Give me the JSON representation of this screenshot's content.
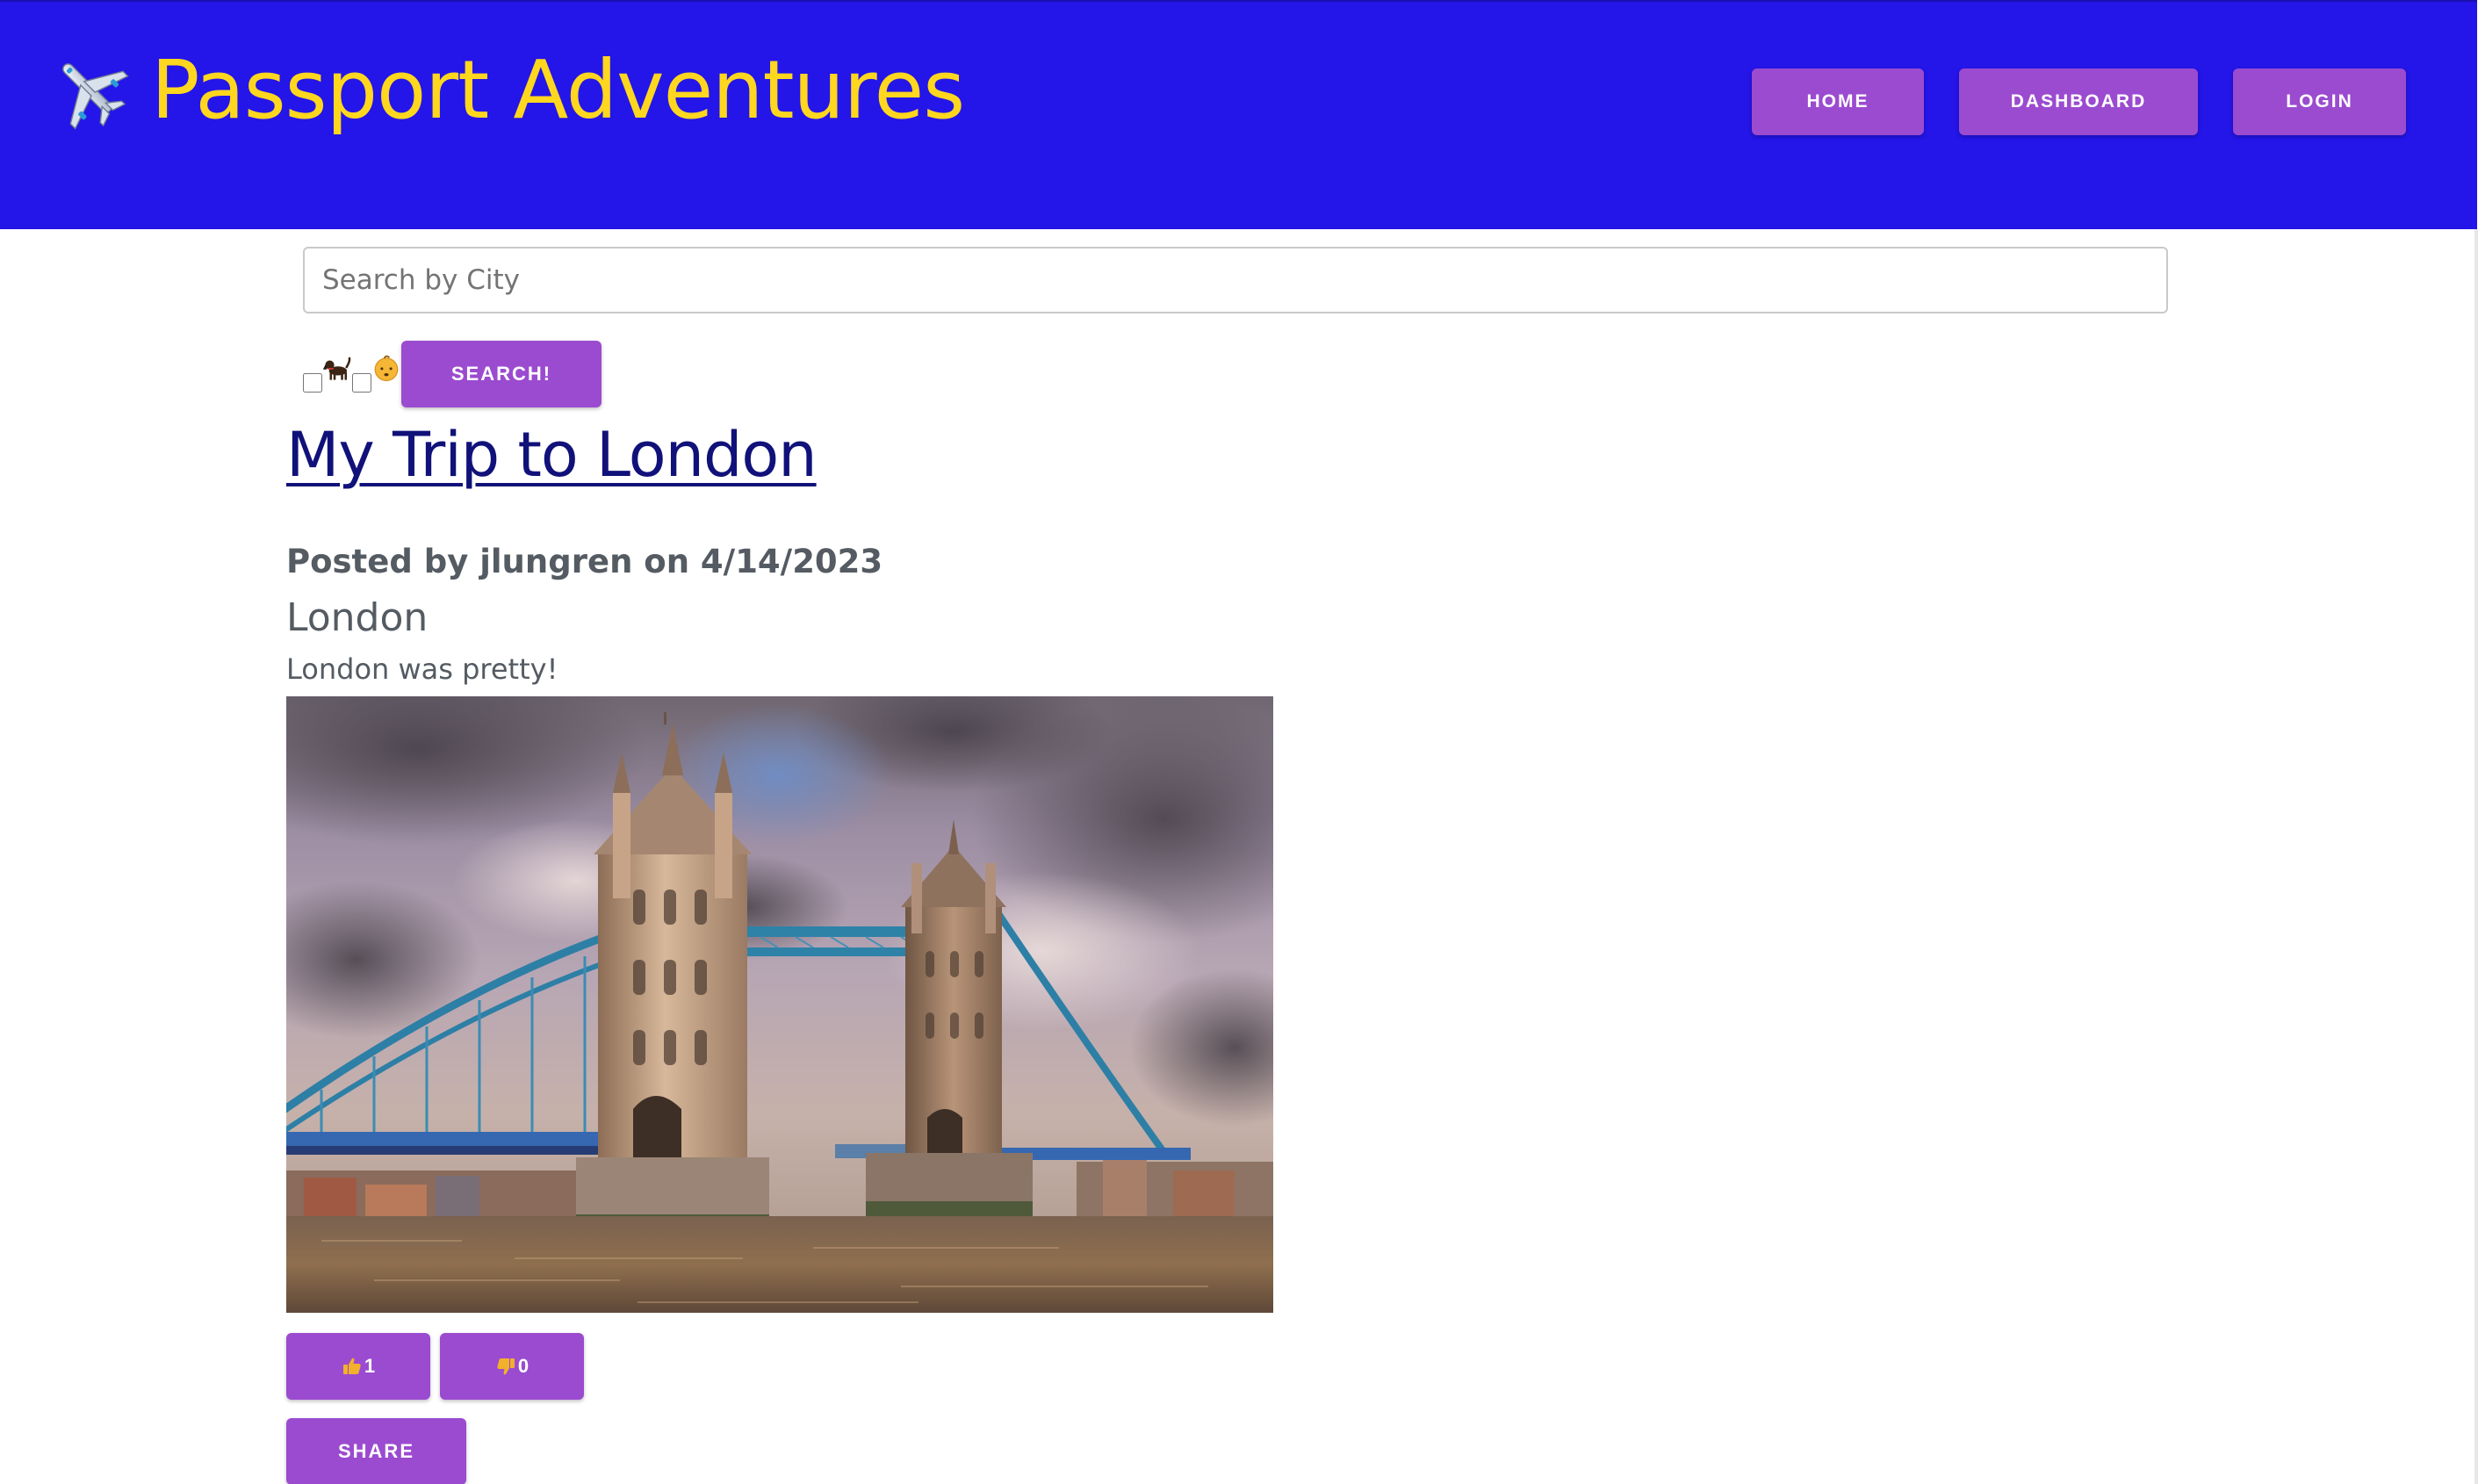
{
  "header": {
    "logo_icon": "airplane-icon",
    "title": "Passport Adventures",
    "title_color": "#ffd71f",
    "background_color": "#2415e8",
    "nav": {
      "home_label": "HOME",
      "dashboard_label": "DASHBOARD",
      "login_label": "LOGIN"
    }
  },
  "search": {
    "placeholder": "Search by City",
    "value": "",
    "filters": [
      {
        "icon": "dog-icon",
        "checked": false
      },
      {
        "icon": "baby-icon",
        "checked": false
      }
    ],
    "button_label": "SEARCH!"
  },
  "post": {
    "title": "My Trip to London",
    "meta": "Posted by jlungren on 4/14/2023",
    "city": "London",
    "body": "London was pretty!",
    "image": {
      "subject": "Tower Bridge, London, under a dramatic cloudy sky"
    },
    "likes": {
      "icon": "thumbs-up-icon",
      "count": "1"
    },
    "dislikes": {
      "icon": "thumbs-down-icon",
      "count": "0"
    },
    "share_label": "SHARE"
  },
  "theme": {
    "accent_button": "#9b4bd0",
    "link_color": "#11117a",
    "text_muted": "#555b62"
  }
}
